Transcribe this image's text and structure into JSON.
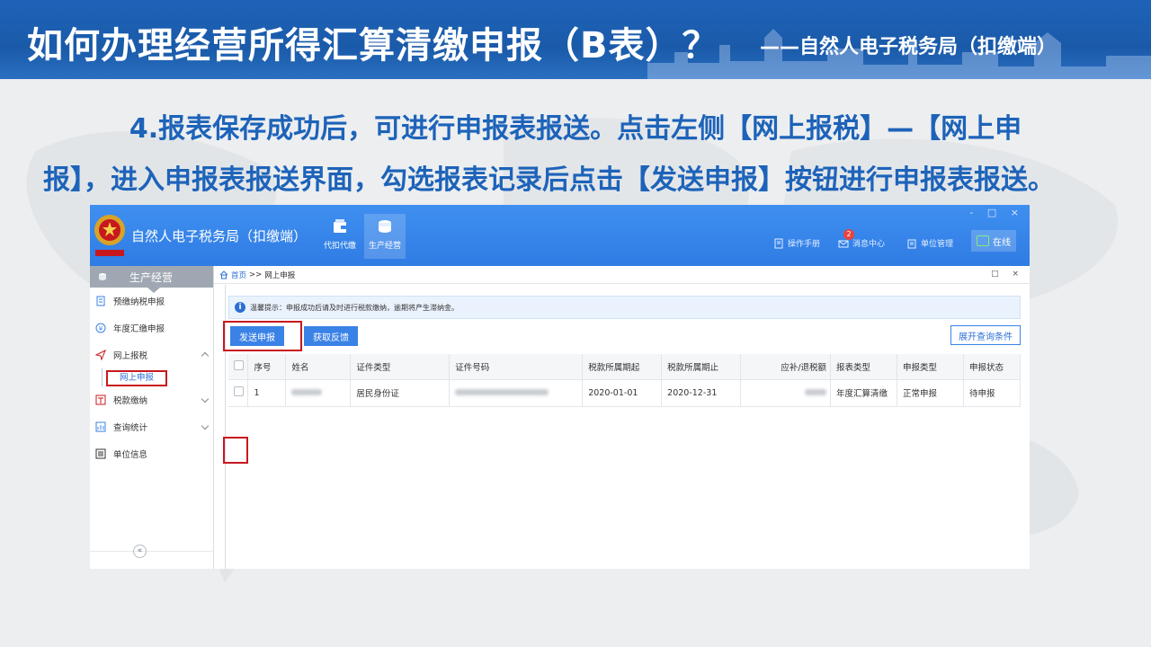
{
  "slide": {
    "title": "如何办理经营所得汇算清缴申报（B表）？",
    "subtitle": "——自然人电子税务局（扣缴端）",
    "instruction_line1": "4.报表保存成功后，可进行申报表报送。点击左侧【网上报税】—【网上申",
    "instruction_line2": "报】，进入申报表报送界面，勾选报表记录后点击【发送申报】按钮进行申报表报送。"
  },
  "app": {
    "title": "自然人电子税务局（扣缴端）",
    "nav_tabs": [
      {
        "label": "代扣代缴",
        "icon": "wallet-icon"
      },
      {
        "label": "生产经营",
        "icon": "coins-icon",
        "active": true
      }
    ],
    "header_links": {
      "manual": "操作手册",
      "messages": "消息中心",
      "message_count": "2",
      "unit_mgmt": "单位管理",
      "status": "在线"
    },
    "window_controls": "- □ ×"
  },
  "sidebar": {
    "title": "生产经营",
    "items": [
      {
        "label": "预缴纳税申报",
        "icon": "document-icon"
      },
      {
        "label": "年度汇缴申报",
        "icon": "yen-icon"
      },
      {
        "label": "网上报税",
        "icon": "send-icon",
        "expanded": true
      },
      {
        "label": "税款缴纳",
        "icon": "tax-icon"
      },
      {
        "label": "查询统计",
        "icon": "chart-icon"
      },
      {
        "label": "单位信息",
        "icon": "building-icon"
      }
    ],
    "subitem": "网上申报",
    "collapse": "«"
  },
  "breadcrumb": {
    "home": "首页",
    "sep": ">>",
    "current": "网上申报",
    "controls": "□ ×"
  },
  "tip": {
    "icon": "i",
    "text": "温馨提示：申报成功后请及时进行税款缴纳，逾期将产生滞纳金。"
  },
  "toolbar": {
    "send": "发送申报",
    "feedback": "获取反馈",
    "expand": "展开查询条件"
  },
  "table": {
    "headers": [
      "序号",
      "姓名",
      "证件类型",
      "证件号码",
      "税款所属期起",
      "税款所属期止",
      "应补/退税额",
      "报表类型",
      "申报类型",
      "申报状态"
    ],
    "rows": [
      {
        "seq": "1",
        "name": "",
        "id_type": "居民身份证",
        "id_no": "",
        "period_start": "2020-01-01",
        "period_end": "2020-12-31",
        "amount": "",
        "report_type": "年度汇算清缴",
        "decl_type": "正常申报",
        "status": "待申报"
      }
    ]
  },
  "colors": {
    "banner_blue": "#1a5aa9",
    "app_header_blue": "#3a88ec",
    "highlight_red": "#c8181e",
    "instruction_blue": "#1d63b9"
  }
}
